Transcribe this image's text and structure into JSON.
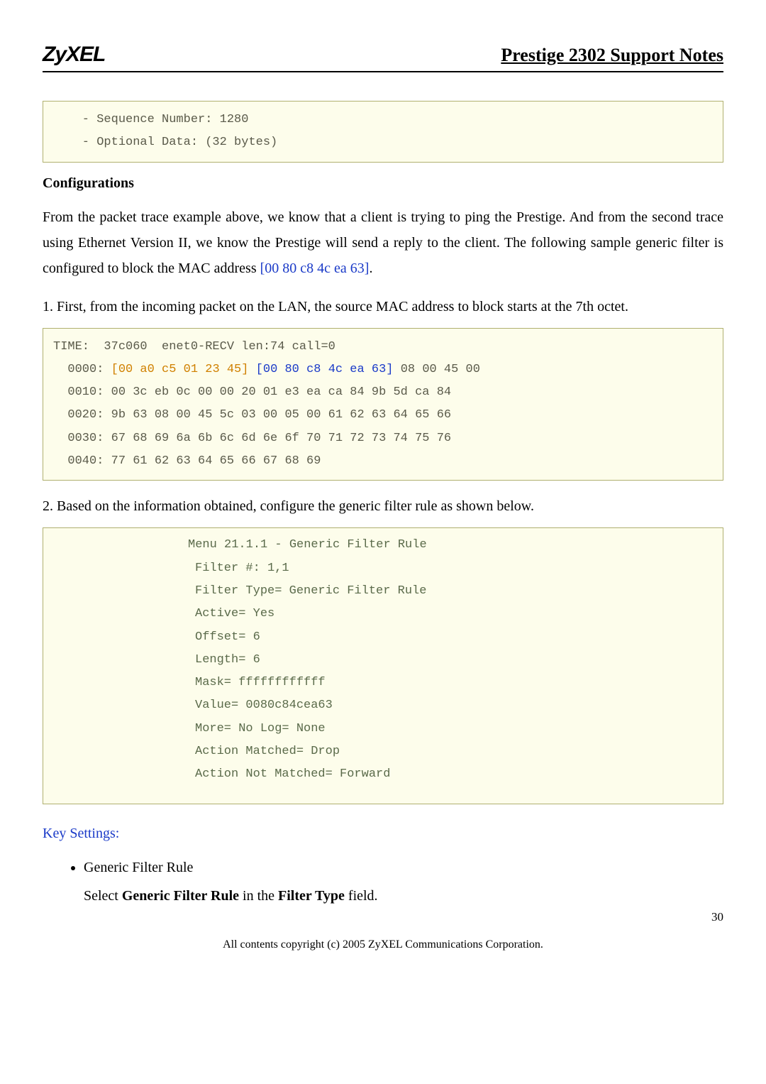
{
  "header": {
    "logo": "ZyXEL",
    "title": "Prestige 2302 Support Notes"
  },
  "block1": {
    "line1": "    - Sequence Number: 1280",
    "line2": "    - Optional Data: (32 bytes)"
  },
  "headings": {
    "configurations": "Configurations",
    "key_settings": "Key Settings:"
  },
  "paragraphs": {
    "p1_a": "From the packet trace example above, we know that a client is trying to ping the Prestige. And from the second trace using Ethernet Version II, we know the Prestige will send a reply to the client. The following sample generic filter is configured to block the MAC address ",
    "p1_mac": "[00 80 c8 4c ea 63]",
    "p1_b": ".",
    "p2": "1. First, from the incoming packet on the LAN, the source MAC address to block starts at the 7th octet.",
    "p3": "2. Based on the information obtained, configure the generic filter rule as shown below."
  },
  "trace": {
    "l0": "TIME:  37c060  enet0-RECV len:74 call=0",
    "l1a": "  0000: ",
    "l1_orange": "[00 a0 c5 01 23 45]",
    "l1_sp": " ",
    "l1_blue": "[00 80 c8 4c ea 63]",
    "l1b": " 08 00 45 00",
    "l2": "  0010: 00 3c eb 0c 00 00 20 01 e3 ea ca 84 9b 5d ca 84",
    "l3": "  0020: 9b 63 08 00 45 5c 03 00 05 00 61 62 63 64 65 66",
    "l4": "  0030: 67 68 69 6a 6b 6c 6d 6e 6f 70 71 72 73 74 75 76",
    "l5": "  0040: 77 61 62 63 64 65 66 67 68 69"
  },
  "menu": {
    "title": "Menu 21.1.1 - Generic Filter Rule",
    "filter_no": "Filter #: 1,1",
    "filter_type": "Filter Type= Generic Filter Rule",
    "active": "Active= Yes",
    "offset": "Offset= 6",
    "length": "Length= 6",
    "mask": "Mask= ffffffffffff",
    "value": "Value= 0080c84cea63",
    "more_log": "More= No           Log= None",
    "action_matched": "Action Matched= Drop",
    "action_not_matched": "Action Not Matched= Forward"
  },
  "bullets": {
    "b1": "Generic Filter Rule",
    "b1_line_a": "Select ",
    "b1_line_b": "Generic Filter Rule",
    "b1_line_c": " in the ",
    "b1_line_d": "Filter Type",
    "b1_line_e": " field."
  },
  "footer": {
    "copyright": "All contents copyright (c) 2005 ZyXEL Communications Corporation.",
    "page": "30"
  }
}
